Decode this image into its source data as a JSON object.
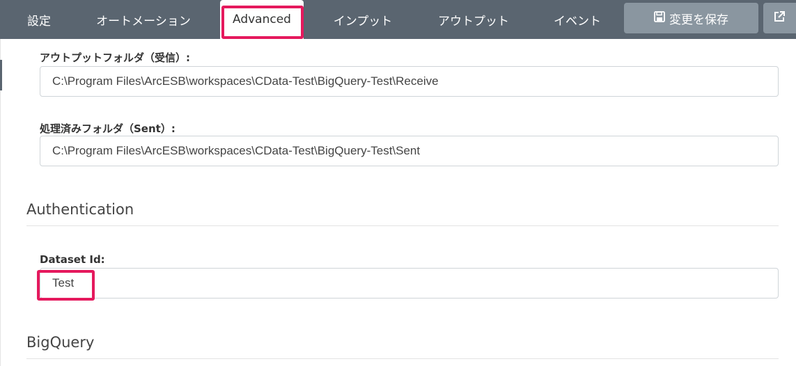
{
  "tabs": [
    {
      "label": "設定"
    },
    {
      "label": "オートメーション"
    },
    {
      "label": "Advanced"
    },
    {
      "label": "インプット"
    },
    {
      "label": "アウトプット"
    },
    {
      "label": "イベント"
    }
  ],
  "toolbar": {
    "save_label": "変更を保存",
    "save_icon": "floppy-disk-icon",
    "external_icon": "external-link-icon"
  },
  "fields": {
    "output_folder": {
      "label": "アウトプットフォルダ（受信）:",
      "value": "C:\\Program Files\\ArcESB\\workspaces\\CData-Test\\BigQuery-Test\\Receive"
    },
    "sent_folder": {
      "label": "処理済みフォルダ（Sent）:",
      "value": "C:\\Program Files\\ArcESB\\workspaces\\CData-Test\\BigQuery-Test\\Sent"
    },
    "dataset_id": {
      "label": "Dataset Id:",
      "value": "Test"
    }
  },
  "sections": {
    "authentication": "Authentication",
    "bigquery": "BigQuery"
  },
  "colors": {
    "topbar": "#5a6570",
    "button": "#8a96a0",
    "highlight": "#e5195d"
  }
}
